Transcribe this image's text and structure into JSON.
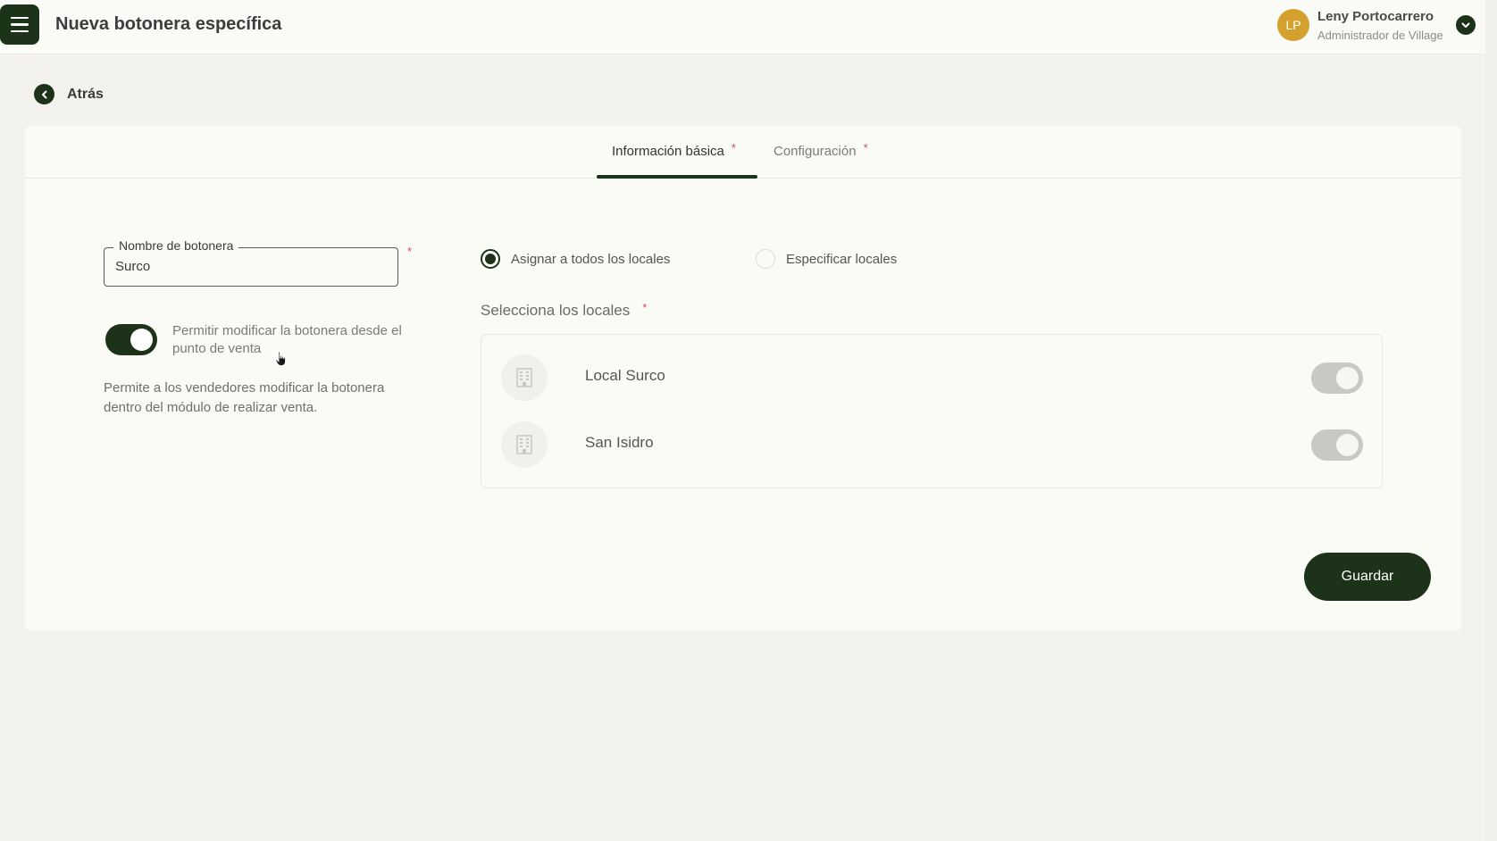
{
  "header": {
    "title": "Nueva botonera específica",
    "user": {
      "initials": "LP",
      "name": "Leny Portocarrero",
      "role": "Administrador de Village"
    }
  },
  "back": {
    "label": "Atrás"
  },
  "tabs": [
    {
      "label": "Información básica",
      "required": "*",
      "active": true
    },
    {
      "label": "Configuración",
      "required": "*",
      "active": false
    }
  ],
  "form": {
    "name_field": {
      "label": "Nombre de botonera",
      "value": "Surco",
      "required": "*"
    },
    "allow_edit": {
      "label": "Permitir modificar la botonera desde el punto de venta",
      "enabled": true,
      "help": "Permite a los vendedores modificar la botonera dentro del módulo de realizar venta."
    },
    "assign_options": [
      {
        "label": "Asignar a todos los locales",
        "selected": true
      },
      {
        "label": "Especificar locales",
        "selected": false
      }
    ],
    "locales_section": {
      "title": "Selecciona los locales",
      "required": "*",
      "items": [
        {
          "name": "Local Surco",
          "icon": "building-icon",
          "enabled": true
        },
        {
          "name": "San Isidro",
          "icon": "building-icon",
          "enabled": true
        }
      ]
    },
    "save_label": "Guardar"
  },
  "colors": {
    "primary": "#1c3319",
    "accent_required": "#d54b5a",
    "avatar": "#d4a02e",
    "background": "#f3f2ef"
  }
}
